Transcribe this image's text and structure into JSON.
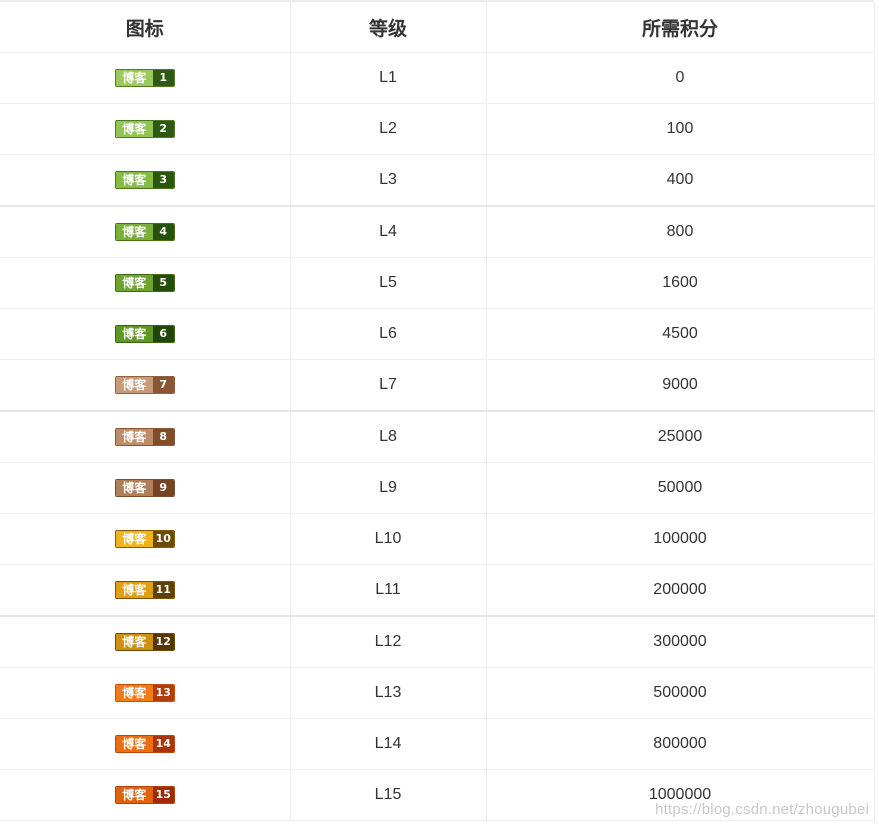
{
  "table": {
    "headers": [
      "图标",
      "等级",
      "所需积分"
    ],
    "rows": [
      {
        "badge_label": "博客",
        "badge_num": "1",
        "level": "L1",
        "points": "0",
        "light": "#9cc95e",
        "dark": "#2f5a12",
        "edge": "#4f7d22"
      },
      {
        "badge_label": "博客",
        "badge_num": "2",
        "level": "L2",
        "points": "100",
        "light": "#92c452",
        "dark": "#2d5a10",
        "edge": "#4c7b20"
      },
      {
        "badge_label": "博客",
        "badge_num": "3",
        "level": "L3",
        "points": "400",
        "light": "#86bb44",
        "dark": "#2a560d",
        "edge": "#49781c"
      },
      {
        "badge_label": "博客",
        "badge_num": "4",
        "level": "L4",
        "points": "800",
        "light": "#7aaf39",
        "dark": "#27520b",
        "edge": "#457219"
      },
      {
        "badge_label": "博客",
        "badge_num": "5",
        "level": "L5",
        "points": "1600",
        "light": "#6ea42e",
        "dark": "#244d09",
        "edge": "#416c16"
      },
      {
        "badge_label": "博客",
        "badge_num": "6",
        "level": "L6",
        "points": "4500",
        "light": "#5f9823",
        "dark": "#204707",
        "edge": "#3b6512"
      },
      {
        "badge_label": "博客",
        "badge_num": "7",
        "level": "L7",
        "points": "9000",
        "light": "#c89a78",
        "dark": "#8a5634",
        "edge": "#94603c"
      },
      {
        "badge_label": "博客",
        "badge_num": "8",
        "level": "L8",
        "points": "25000",
        "light": "#be8c68",
        "dark": "#7f4d2c",
        "edge": "#8a5636"
      },
      {
        "badge_label": "博客",
        "badge_num": "9",
        "level": "L9",
        "points": "50000",
        "light": "#b27e5a",
        "dark": "#744324",
        "edge": "#7e4c2e"
      },
      {
        "badge_label": "博客",
        "badge_num": "10",
        "level": "L10",
        "points": "100000",
        "light": "#f2b21a",
        "dark": "#6f4a06",
        "edge": "#8a5c0a"
      },
      {
        "badge_label": "博客",
        "badge_num": "11",
        "level": "L11",
        "points": "200000",
        "light": "#e0a012",
        "dark": "#5f4005",
        "edge": "#7a5208"
      },
      {
        "badge_label": "博客",
        "badge_num": "12",
        "level": "L12",
        "points": "300000",
        "light": "#cf900d",
        "dark": "#543804",
        "edge": "#6e4906"
      },
      {
        "badge_label": "博客",
        "badge_num": "13",
        "level": "L13",
        "points": "500000",
        "light": "#f47a14",
        "dark": "#b33c0a",
        "edge": "#c5500e"
      },
      {
        "badge_label": "博客",
        "badge_num": "14",
        "level": "L14",
        "points": "800000",
        "light": "#ec6e10",
        "dark": "#a93408",
        "edge": "#bd480c"
      },
      {
        "badge_label": "博客",
        "badge_num": "15",
        "level": "L15",
        "points": "1000000",
        "light": "#e2620c",
        "dark": "#9f2c06",
        "edge": "#b4400a"
      }
    ]
  },
  "watermark": "https://blog.csdn.net/zhougubei"
}
